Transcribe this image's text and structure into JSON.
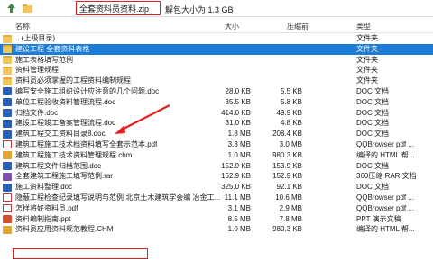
{
  "toolbar": {
    "path_text": "全套资料员资料.zip",
    "unpack_size": "解包大小为 1.3 GB"
  },
  "columns": {
    "name": "名称",
    "size": "大小",
    "compressed": "压缩前",
    "type": "类型"
  },
  "files": [
    {
      "name": ".. (上级目录)",
      "size": "",
      "csize": "",
      "type": "文件夹",
      "icon": "folder",
      "state": ""
    },
    {
      "name": "建设工程 全套资料表格",
      "size": "",
      "csize": "",
      "type": "文件夹",
      "icon": "folder",
      "state": "sel"
    },
    {
      "name": "施工表格填写范例",
      "size": "",
      "csize": "",
      "type": "文件夹",
      "icon": "folder",
      "state": ""
    },
    {
      "name": "资料管理规程",
      "size": "",
      "csize": "",
      "type": "文件夹",
      "icon": "folder",
      "state": ""
    },
    {
      "name": "资料员必须掌握的工程资料编制规程",
      "size": "",
      "csize": "",
      "type": "文件夹",
      "icon": "folder",
      "state": ""
    },
    {
      "name": "编写安全施工组织设计应注意的几个问题.doc",
      "size": "28.0 KB",
      "csize": "5.5 KB",
      "type": "DOC 文档",
      "icon": "doc",
      "state": ""
    },
    {
      "name": "单位工程验收资料管理流程.doc",
      "size": "35.5 KB",
      "csize": "5.8 KB",
      "type": "DOC 文档",
      "icon": "doc",
      "state": ""
    },
    {
      "name": "归档文件.doc",
      "size": "414.0 KB",
      "csize": "49.9 KB",
      "type": "DOC 文档",
      "icon": "doc",
      "state": ""
    },
    {
      "name": "建设工程竣工备案管理流程.doc",
      "size": "31.0 KB",
      "csize": "4.8 KB",
      "type": "DOC 文档",
      "icon": "doc",
      "state": ""
    },
    {
      "name": "建筑工程交工资料目录8.doc",
      "size": "1.8 MB",
      "csize": "208.4 KB",
      "type": "DOC 文档",
      "icon": "doc",
      "state": ""
    },
    {
      "name": "建筑工程施工技术档资料填写全套示范本.pdf",
      "size": "3.3 MB",
      "csize": "3.0 MB",
      "type": "QQBrowser pdf ...",
      "icon": "pdf",
      "state": ""
    },
    {
      "name": "建筑工程施工技术资料管理规程.chm",
      "size": "1.0 MB",
      "csize": "980.3 KB",
      "type": "编译的 HTML 帮...",
      "icon": "chm",
      "state": ""
    },
    {
      "name": "建筑工程文件归档范围.doc",
      "size": "152.9 KB",
      "csize": "153.9 KB",
      "type": "DOC 文档",
      "icon": "doc",
      "state": ""
    },
    {
      "name": "全套建筑工程施工填写范例.rar",
      "size": "152.9 KB",
      "csize": "152.9 KB",
      "type": "360压缩 RAR 文档",
      "icon": "rar",
      "state": ""
    },
    {
      "name": "施工资料整理.doc",
      "size": "325.0 KB",
      "csize": "92.1 KB",
      "type": "DOC 文档",
      "icon": "doc",
      "state": ""
    },
    {
      "name": "隐蔽工程检查纪录填写说明与范例 北京土木建筑学会编 冶金工...",
      "size": "11.1 MB",
      "csize": "10.6 MB",
      "type": "QQBrowser pdf ...",
      "icon": "pdf",
      "state": ""
    },
    {
      "name": "怎样将好资料员.pdf",
      "size": "3.1 MB",
      "csize": "2.9 MB",
      "type": "QQBrowser pdf ...",
      "icon": "pdf",
      "state": ""
    },
    {
      "name": "资料编制指南.ppt",
      "size": "8.5 MB",
      "csize": "7.8 MB",
      "type": "PPT 演示文稿",
      "icon": "ppt",
      "state": ""
    },
    {
      "name": "资料员应用资料规范教程.CHM",
      "size": "1.0 MB",
      "csize": "980.3 KB",
      "type": "编译的 HTML 帮...",
      "icon": "chm",
      "state": ""
    }
  ]
}
